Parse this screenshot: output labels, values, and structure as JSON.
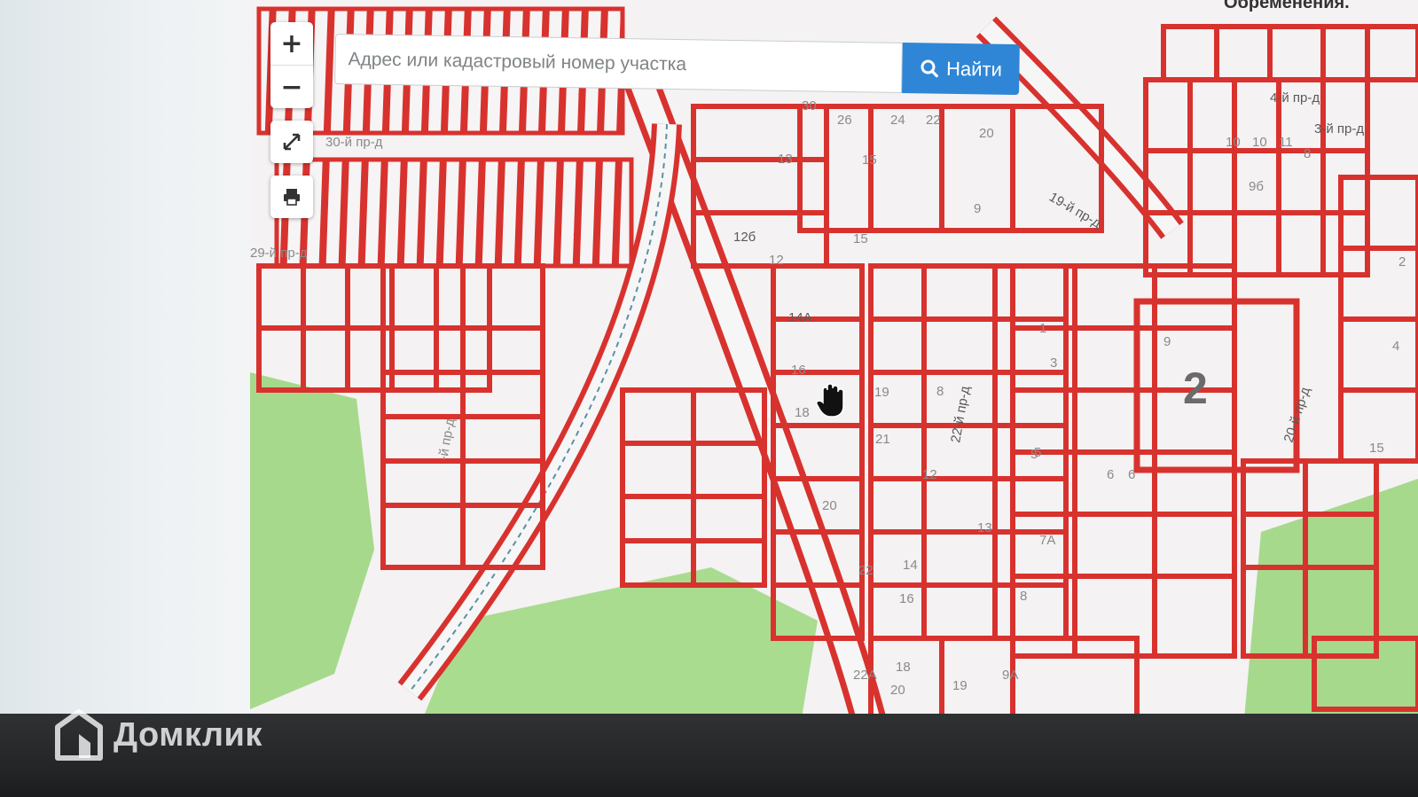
{
  "search": {
    "placeholder": "Адрес или кадастровый номер участка",
    "button_label": "Найти"
  },
  "controls": {
    "zoom_in": "+",
    "zoom_out": "−",
    "fullscreen_icon": "expand-icon",
    "print_icon": "print-icon"
  },
  "header": {
    "partial_text": "Обременения."
  },
  "watermark": {
    "brand": "Домклик"
  },
  "map": {
    "streets": [
      "4-й пр-д",
      "3-й пр-д",
      "19-й пр-д",
      "22-й пр-д",
      "20-й пр-д",
      "30-й пр-д",
      "29-й пр-д",
      "-й пр-д"
    ],
    "parcel_numbers": [
      "30",
      "26",
      "24",
      "22",
      "20",
      "15",
      "13",
      "10",
      "12б",
      "15",
      "12",
      "14А",
      "16",
      "18",
      "20",
      "19",
      "8",
      "21",
      "9",
      "6",
      "5",
      "12",
      "13",
      "14",
      "16",
      "22",
      "18",
      "20",
      "19",
      "9А",
      "22А",
      "7А",
      "8",
      "5",
      "6",
      "9",
      "3",
      "1",
      "10",
      "11",
      "8",
      "9б",
      "15",
      "4",
      "2"
    ],
    "big_parcel_number": "2"
  },
  "colors": {
    "parcel_border": "#d8322e",
    "road": "#f6f6f6",
    "green_area": "#a6d98c",
    "search_button": "#2f86d6",
    "bottom_bar": "#262729"
  }
}
